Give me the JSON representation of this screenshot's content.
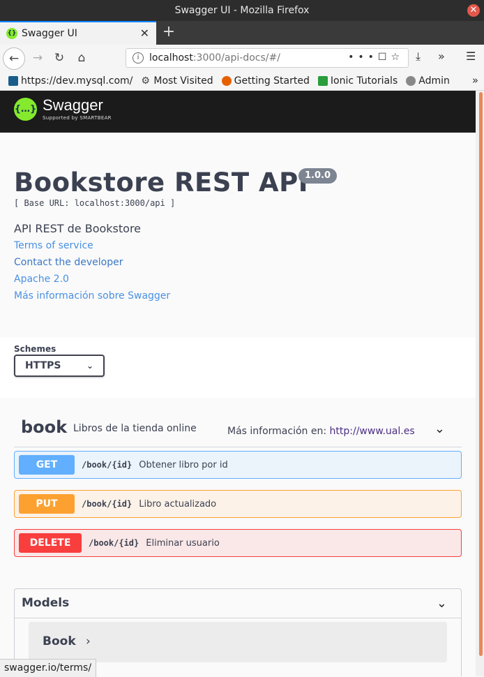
{
  "window": {
    "title": "Swagger UI - Mozilla Firefox"
  },
  "tab": {
    "label": "Swagger UI"
  },
  "address": {
    "host": "localhost",
    "path": ":3000/api-docs/#/"
  },
  "bookmarks": [
    {
      "label": "https://dev.mysql.com/",
      "icon": "mysql-icon"
    },
    {
      "label": "Most Visited",
      "icon": "gear-icon"
    },
    {
      "label": "Getting Started",
      "icon": "firefox-icon"
    },
    {
      "label": "Ionic Tutorials",
      "icon": "ual-icon"
    },
    {
      "label": "Admin",
      "icon": "admin-icon"
    }
  ],
  "swagger": {
    "brand": "Swagger",
    "tagline": "Supported by SMARTBEAR",
    "logo_glyph": "{…}"
  },
  "info": {
    "title": "Bookstore REST API",
    "version": "1.0.0",
    "base_url": "[ Base URL: localhost:3000/api ]",
    "description": "API REST de Bookstore",
    "links": [
      "Terms of service",
      "Contact the developer",
      "Apache 2.0",
      "Más información sobre Swagger"
    ]
  },
  "schemes": {
    "label": "Schemes",
    "selected": "HTTPS"
  },
  "tag": {
    "name": "book",
    "description": "Libros de la tienda online",
    "more_label": "Más información en:",
    "more_url": "http://www.ual.es"
  },
  "operations": [
    {
      "method": "GET",
      "path": "/book/{id}",
      "summary": "Obtener libro por id"
    },
    {
      "method": "PUT",
      "path": "/book/{id}",
      "summary": "Libro actualizado"
    },
    {
      "method": "DELETE",
      "path": "/book/{id}",
      "summary": "Eliminar usuario"
    }
  ],
  "models": {
    "title": "Models",
    "items": [
      "Book"
    ]
  },
  "status_url": "swagger.io/terms/",
  "colors": {
    "get": "#61affe",
    "put": "#fca130",
    "delete": "#f93e3e",
    "swagger_green": "#85ea2d"
  }
}
